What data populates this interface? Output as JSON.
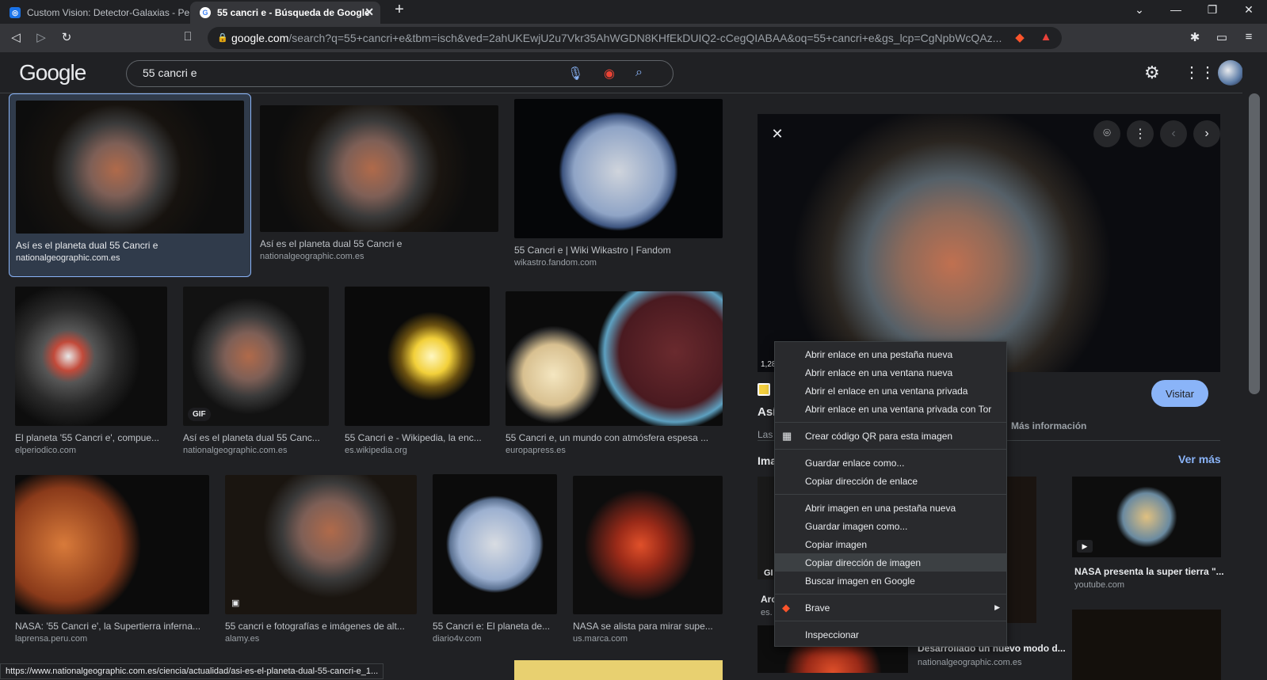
{
  "tabs": [
    {
      "title": "Custom Vision: Detector-Galaxias - Pe",
      "active": false
    },
    {
      "title": "55 cancri e - Búsqueda de Google",
      "active": true
    }
  ],
  "address": {
    "host": "google.com",
    "rest": "/search?q=55+cancri+e&tbm=isch&ved=2ahUKEwjU2u7Vkr35AhWGDN8KHfEkDUIQ2-cCegQIABAA&oq=55+cancri+e&gs_lcp=CgNpbWcQAz..."
  },
  "header": {
    "logo": "Google",
    "query": "55 cancri e"
  },
  "results": [
    {
      "title": "Así es el planeta dual 55 Cancri e",
      "source": "nationalgeographic.com.es"
    },
    {
      "title": "Así es el planeta dual 55 Cancri e",
      "source": "nationalgeographic.com.es"
    },
    {
      "title": "55 Cancri e | Wiki Wikastro | Fandom",
      "source": "wikastro.fandom.com"
    },
    {
      "title": "El planeta '55 Cancri e', compue...",
      "source": "elperiodico.com"
    },
    {
      "title": "Así es el planeta dual 55 Canc...",
      "source": "nationalgeographic.com.es",
      "badge": "GIF"
    },
    {
      "title": "55 Cancri e - Wikipedia, la enc...",
      "source": "es.wikipedia.org"
    },
    {
      "title": "55 Cancri e, un mundo con atmósfera espesa ...",
      "source": "europapress.es"
    },
    {
      "title": "NASA: '55 Cancri e', la Supertierra inferna...",
      "source": "laprensa.peru.com"
    },
    {
      "title": "55 cancri e fotografías e imágenes de alt...",
      "source": "alamy.es"
    },
    {
      "title": "55 Cancri e: El planeta de...",
      "source": "diario4v.com"
    },
    {
      "title": "NASA se alista para mirar supe...",
      "source": "us.marca.com"
    }
  ],
  "panel": {
    "visit_label": "Visitar",
    "more_info": "Más información",
    "see_more": "Ver más",
    "partial_title": "Así",
    "partial_las": "Las",
    "partial_ima": "Ima",
    "partial_size": "1,28",
    "partial_arc": "Arc",
    "partial_es": "es.",
    "related": [
      {
        "title": "NASA presenta la super tierra \"...",
        "source": "youtube.com"
      },
      {
        "title": "Desarrollado un nuevo modo d...",
        "source": "nationalgeographic.com.es"
      }
    ]
  },
  "context_menu": [
    [
      "Abrir enlace en una pestaña nueva",
      "Abrir enlace en una ventana nueva",
      "Abrir el enlace en una ventana privada",
      "Abrir enlace en una ventana privada con Tor"
    ],
    [
      "Crear código QR para esta imagen"
    ],
    [
      "Guardar enlace como...",
      "Copiar dirección de enlace"
    ],
    [
      "Abrir imagen en una pestaña nueva",
      "Guardar imagen como...",
      "Copiar imagen",
      "Copiar dirección de imagen",
      "Buscar imagen en Google"
    ],
    [
      "Brave"
    ],
    [
      "Inspeccionar"
    ]
  ],
  "status_url": "https://www.nationalgeographic.com.es/ciencia/actualidad/asi-es-el-planeta-dual-55-cancri-e_1...",
  "colors": {
    "accent": "#8ab4f8",
    "bg": "#202124",
    "selected": "#303b4b"
  }
}
